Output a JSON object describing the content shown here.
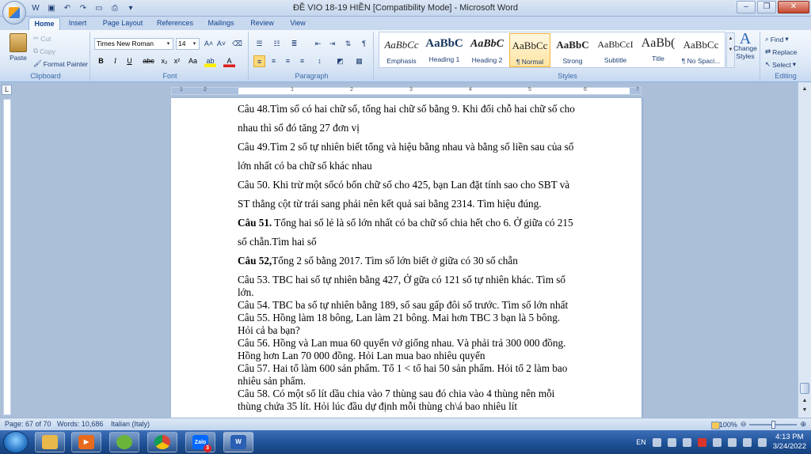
{
  "window": {
    "title": "ĐỀ VIO 18-19 HIỀN [Compatibility Mode] - Microsoft Word"
  },
  "tabs": [
    "Home",
    "Insert",
    "Page Layout",
    "References",
    "Mailings",
    "Review",
    "View"
  ],
  "clipboard": {
    "paste": "Paste",
    "cut": "Cut",
    "copy": "Copy",
    "format_painter": "Format Painter",
    "label": "Clipboard"
  },
  "font": {
    "family": "Times New Roman",
    "size": "14",
    "label": "Font"
  },
  "paragraph": {
    "label": "Paragraph"
  },
  "styles": {
    "label": "Styles",
    "items": [
      {
        "sample": "AaBbCc",
        "name": "Emphasis"
      },
      {
        "sample": "AaBbC",
        "name": "Heading 1"
      },
      {
        "sample": "AaBbC",
        "name": "Heading 2"
      },
      {
        "sample": "AaBbCc",
        "name": "¶ Normal"
      },
      {
        "sample": "AaBbC",
        "name": "Strong"
      },
      {
        "sample": "AaBbCcI",
        "name": "Subtitle"
      },
      {
        "sample": "AaBb(",
        "name": "Title"
      },
      {
        "sample": "AaBbCc",
        "name": "¶ No Spaci..."
      }
    ],
    "change_styles": "Change Styles"
  },
  "editing": {
    "find": "Find",
    "replace": "Replace",
    "select": "Select",
    "label": "Editing"
  },
  "ruler_numbers": [
    "1",
    "2",
    "1",
    "2",
    "3",
    "4",
    "5",
    "6",
    "7"
  ],
  "document": {
    "lines": [
      {
        "text": "Câu 48.Tìm số có hai chữ số, tổng hai chữ số bằng 9. Khi đổi chỗ hai chữ số cho"
      },
      {
        "text": "nhau thì số đó tăng 27 đơn vị"
      },
      {
        "text": "Câu 49.Tìm 2 số tự nhiên biết tổng và hiệu bằng nhau và bằng số liền sau của số"
      },
      {
        "text": "lớn nhất có ba chữ số khác nhau"
      },
      {
        "text": "Câu 50. Khi trừ một sốcó bốn chữ số cho 425, bạn Lan đặt tính sao cho SBT và"
      },
      {
        "text": "ST thẳng cột từ trái sang phải nên kết quả sai bằng 2314. Tìm hiệu đúng."
      },
      {
        "bold": "Câu 51.",
        "text": " Tổng hai số lẻ là số lớn nhất có ba chữ  số chia hết cho 6. Ở giữa có 215"
      },
      {
        "text": "số chẵn.Tìm hai số"
      },
      {
        "bold": "Câu 52,",
        "text": "Tổng 2 số bằng 2017. Tìm số lớn biết ở giữa  có 30 số chẵn"
      },
      {
        "text": "Câu 53. TBC hai số tự nhiên bằng 427, Ở gữa có 121 số tự nhiên khác. Tìm số"
      },
      {
        "text": "lớn."
      },
      {
        "text": "Câu 54. TBC ba số tự nhiên bằng 189, số sau gấp đôi số trước. Tìm số lớn nhất"
      },
      {
        "text": "Câu 55. Hồng làm 18 bông, Lan làm 21 bông. Mai hơn TBC 3 bạn là 5 bông."
      },
      {
        "text": "Hỏi cả ba bạn?"
      },
      {
        "text": "Câu 56. Hồng và Lan mua 60 quyển vở giống nhau. Và phải trả 300 000 đồng."
      },
      {
        "text": "Hồng hơn Lan 70 000 đồng. Hỏi Lan mua bao nhiêu quyển"
      },
      {
        "text": "Câu 57. Hai tổ làm 600 sản phẩm. Tổ 1 < tổ hai 50 sản phẩm. Hỏi tổ 2 làm bao"
      },
      {
        "text": "nhiêu sản phẩm."
      },
      {
        "text": "Câu 58. Có một số lít dầu chia vào 7 thùng sau đó chia vào 4 thùng nên mỗi"
      },
      {
        "text": "thùng chứa 35 lít. Hỏi lúc đầu dự định mỗi thùng ch\\á bao nhiêu lít"
      }
    ]
  },
  "status": {
    "page": "Page: 67 of 70",
    "words": "Words: 10,686",
    "language": "Italian (Italy)",
    "zoom": "100%"
  },
  "taskbar": {
    "apps": [
      "explorer",
      "media",
      "utility",
      "chrome",
      "Zalo",
      "word"
    ],
    "zalo_badge": "3"
  },
  "tray": {
    "lang": "EN",
    "time": "4:13 PM",
    "date": "3/24/2022"
  }
}
